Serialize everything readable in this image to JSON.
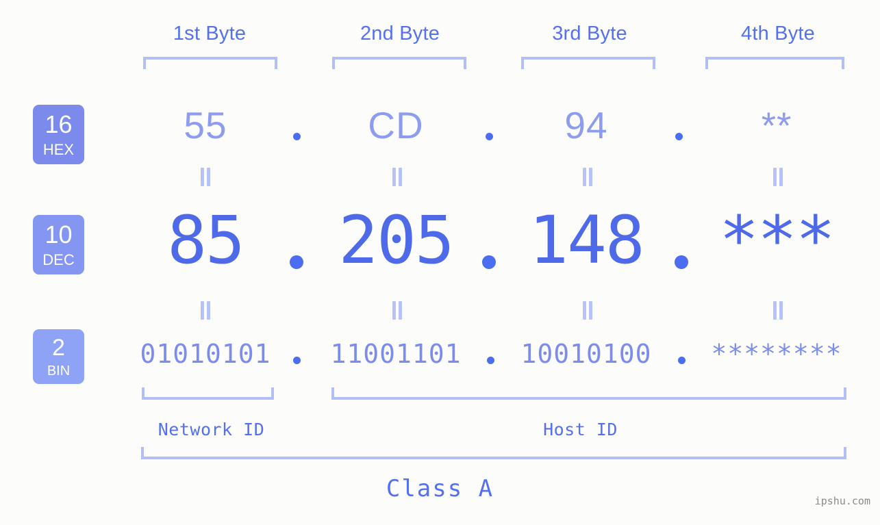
{
  "page": {
    "background_color": "#fcfdfa",
    "accent_color": "#5470f0",
    "bracket_color": "#b3bef7",
    "watermark": "ipshu.com"
  },
  "byte_headers": [
    {
      "label": "1st Byte"
    },
    {
      "label": "2nd Byte"
    },
    {
      "label": "3rd Byte"
    },
    {
      "label": "4th Byte"
    }
  ],
  "bases": {
    "hex": {
      "num": "16",
      "abbr": "HEX",
      "color": "#7b8aeb"
    },
    "dec": {
      "num": "10",
      "abbr": "DEC",
      "color": "#8496f2"
    },
    "bin": {
      "num": "2",
      "abbr": "BIN",
      "color": "#8fa3f6"
    }
  },
  "rows": {
    "hex": {
      "values": [
        "55",
        "CD",
        "94",
        "**"
      ],
      "separator": "."
    },
    "dec": {
      "values": [
        "85",
        "205",
        "148",
        "***"
      ],
      "separator": "."
    },
    "bin": {
      "values": [
        "01010101",
        "11001101",
        "10010100",
        "********"
      ],
      "separator": "."
    }
  },
  "equals_marks": {
    "row1": [
      "=",
      "=",
      "=",
      "="
    ],
    "row2": [
      "=",
      "=",
      "=",
      "="
    ]
  },
  "id_labels": {
    "network": "Network ID",
    "host": "Host ID"
  },
  "class_label": "Class A"
}
